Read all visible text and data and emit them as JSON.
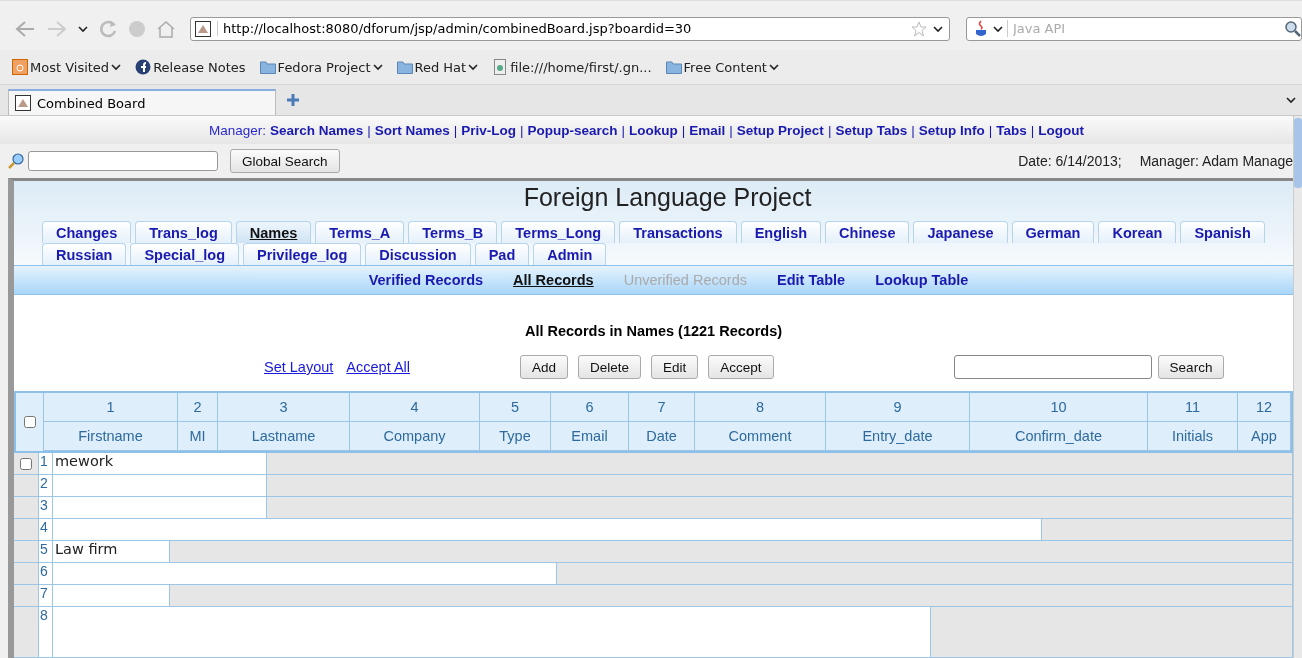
{
  "browser": {
    "url": "http://localhost:8080/dforum/jsp/admin/combinedBoard.jsp?boardid=30",
    "search": {
      "placeholder": "Java API"
    },
    "bookmarks": [
      {
        "label": "Most Visited",
        "kind": "feed",
        "dropdown": true
      },
      {
        "label": "Release Notes",
        "kind": "fedora",
        "dropdown": false
      },
      {
        "label": "Fedora Project",
        "kind": "folder",
        "dropdown": true
      },
      {
        "label": "Red Hat",
        "kind": "folder",
        "dropdown": true
      },
      {
        "label": "file:///home/first/.gn...",
        "kind": "file",
        "dropdown": false
      },
      {
        "label": "Free Content",
        "kind": "folder",
        "dropdown": true
      }
    ],
    "tab": {
      "title": "Combined Board"
    }
  },
  "manager_bar": {
    "label": "Manager:",
    "separator": "|",
    "links": [
      "Search Names",
      "Sort Names",
      "Priv-Log",
      "Popup-search",
      "Lookup",
      "Email",
      "Setup Project",
      "Setup Tabs",
      "Setup Info",
      "Tabs",
      "Logout"
    ]
  },
  "global_search": {
    "button": "Global Search",
    "date": "Date: 6/14/2013;",
    "manager": "Manager: Adam Manage"
  },
  "page": {
    "title": "Foreign Language Project",
    "tab_rows": [
      [
        {
          "label": "Changes",
          "selected": false
        },
        {
          "label": "Trans_log",
          "selected": false
        },
        {
          "label": "Names",
          "selected": true
        },
        {
          "label": "Terms_A",
          "selected": false
        },
        {
          "label": "Terms_B",
          "selected": false
        },
        {
          "label": "Terms_Long",
          "selected": false
        },
        {
          "label": "Transactions",
          "selected": false
        },
        {
          "label": "English",
          "selected": false
        },
        {
          "label": "Chinese",
          "selected": false
        },
        {
          "label": "Japanese",
          "selected": false
        },
        {
          "label": "German",
          "selected": false
        },
        {
          "label": "Korean",
          "selected": false
        },
        {
          "label": "Spanish",
          "selected": false
        }
      ],
      [
        {
          "label": "Russian",
          "selected": false
        },
        {
          "label": "Special_log",
          "selected": false
        },
        {
          "label": "Privilege_log",
          "selected": false
        },
        {
          "label": "Discussion",
          "selected": false
        },
        {
          "label": "Pad",
          "selected": false
        },
        {
          "label": "Admin",
          "selected": false
        }
      ]
    ],
    "subnav": [
      {
        "label": "Verified Records",
        "selected": false,
        "disabled": false
      },
      {
        "label": "All Records",
        "selected": true,
        "disabled": false
      },
      {
        "label": "Unverified Records",
        "selected": false,
        "disabled": true
      },
      {
        "label": "Edit Table",
        "selected": false,
        "disabled": false
      },
      {
        "label": "Lookup Table",
        "selected": false,
        "disabled": false
      }
    ],
    "heading": "All Records in Names (1221 Records)",
    "links": [
      "Set Layout",
      "Accept All"
    ],
    "buttons": [
      "Add",
      "Delete",
      "Edit",
      "Accept"
    ],
    "search_button": "Search",
    "table": {
      "select_all": {
        "checked": false
      },
      "columns": [
        {
          "number": "1",
          "label": "Firstname"
        },
        {
          "number": "2",
          "label": "MI"
        },
        {
          "number": "3",
          "label": "Lastname"
        },
        {
          "number": "4",
          "label": "Company"
        },
        {
          "number": "5",
          "label": "Type"
        },
        {
          "number": "6",
          "label": "Email"
        },
        {
          "number": "7",
          "label": "Date"
        },
        {
          "number": "8",
          "label": "Comment"
        },
        {
          "number": "9",
          "label": "Entry_date"
        },
        {
          "number": "10",
          "label": "Confirm_date"
        },
        {
          "number": "11",
          "label": "Initials"
        },
        {
          "number": "12",
          "label": "App"
        }
      ],
      "rows": [
        {
          "number": "1",
          "text": "mework",
          "checked": false
        },
        {
          "number": "2"
        },
        {
          "number": "3"
        },
        {
          "number": "4"
        },
        {
          "number": "5",
          "text": "Law firm"
        },
        {
          "number": "6"
        },
        {
          "number": "7"
        },
        {
          "number": "8"
        }
      ]
    }
  }
}
